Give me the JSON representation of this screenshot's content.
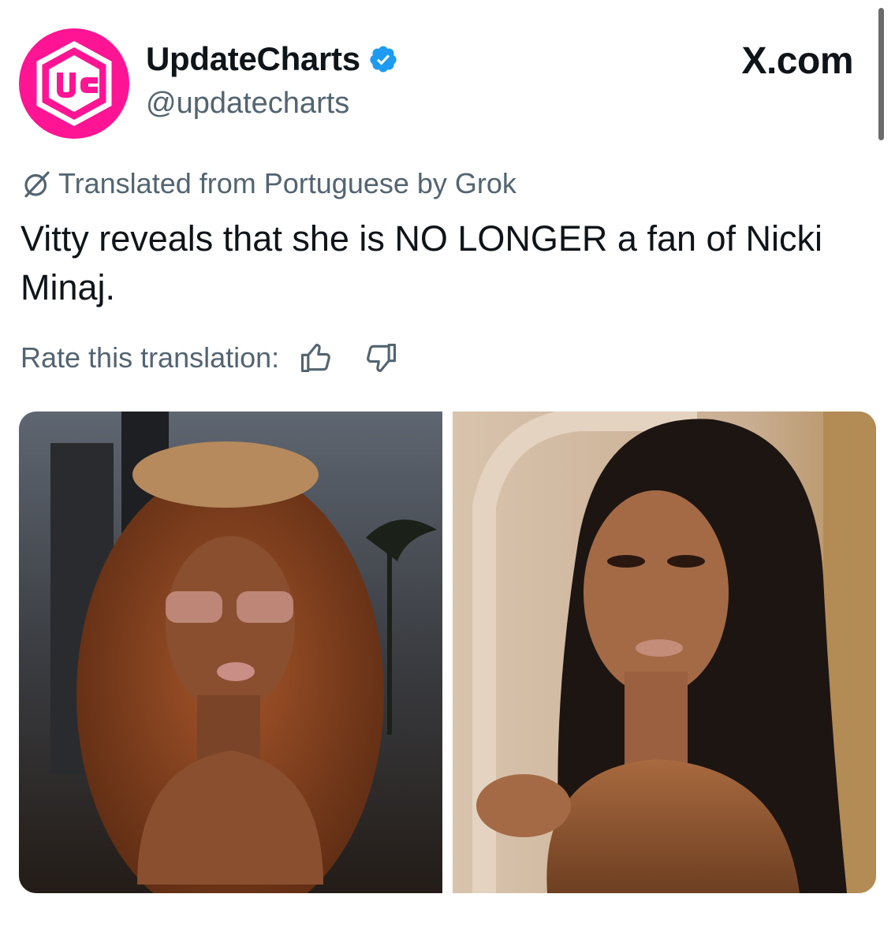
{
  "header": {
    "display_name": "UpdateCharts",
    "handle": "@updatecharts",
    "avatar_logo_text": "UC",
    "site_label": "X.com"
  },
  "translation": {
    "notice": "Translated from Portuguese by Grok",
    "rate_label": "Rate this translation:"
  },
  "post": {
    "text": "Vitty reveals that she is NO LONGER a fan of Nicki Minaj."
  },
  "media": {
    "count": 2
  },
  "colors": {
    "avatar_bg": "#ff1493",
    "verified": "#1d9bf0",
    "secondary_text": "#536471",
    "primary_text": "#0f1419"
  },
  "icons": [
    "verified-badge-icon",
    "grok-translate-icon",
    "thumbs-up-icon",
    "thumbs-down-icon"
  ]
}
